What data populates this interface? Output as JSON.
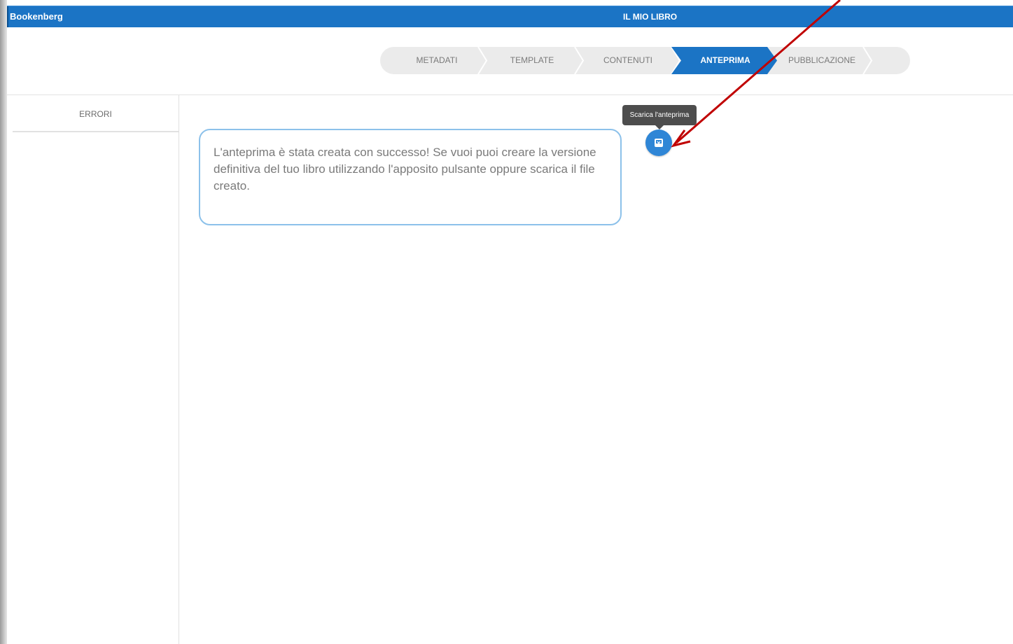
{
  "app": {
    "brand": "Bookenberg",
    "title": "IL MIO LIBRO"
  },
  "wizard": {
    "steps": [
      {
        "label": "METADATI",
        "active": false
      },
      {
        "label": "TEMPLATE",
        "active": false
      },
      {
        "label": "CONTENUTI",
        "active": false
      },
      {
        "label": "ANTEPRIMA",
        "active": true
      },
      {
        "label": "PUBBLICAZIONE",
        "active": false
      }
    ]
  },
  "sidebar": {
    "tab_label": "ERRORI"
  },
  "main": {
    "message": "L'anteprima è stata creata con successo! Se vuoi puoi creare la versione definitiva del tuo libro utilizzando l'apposito pulsante oppure scarica il file creato.",
    "download_tooltip": "Scarica l'anteprima",
    "download_icon": "download-icon"
  },
  "colors": {
    "topbar": "#1b74c5",
    "active_step": "#1b74c5",
    "message_border": "#8cc1ea",
    "annotation_arrow": "#c00000"
  }
}
